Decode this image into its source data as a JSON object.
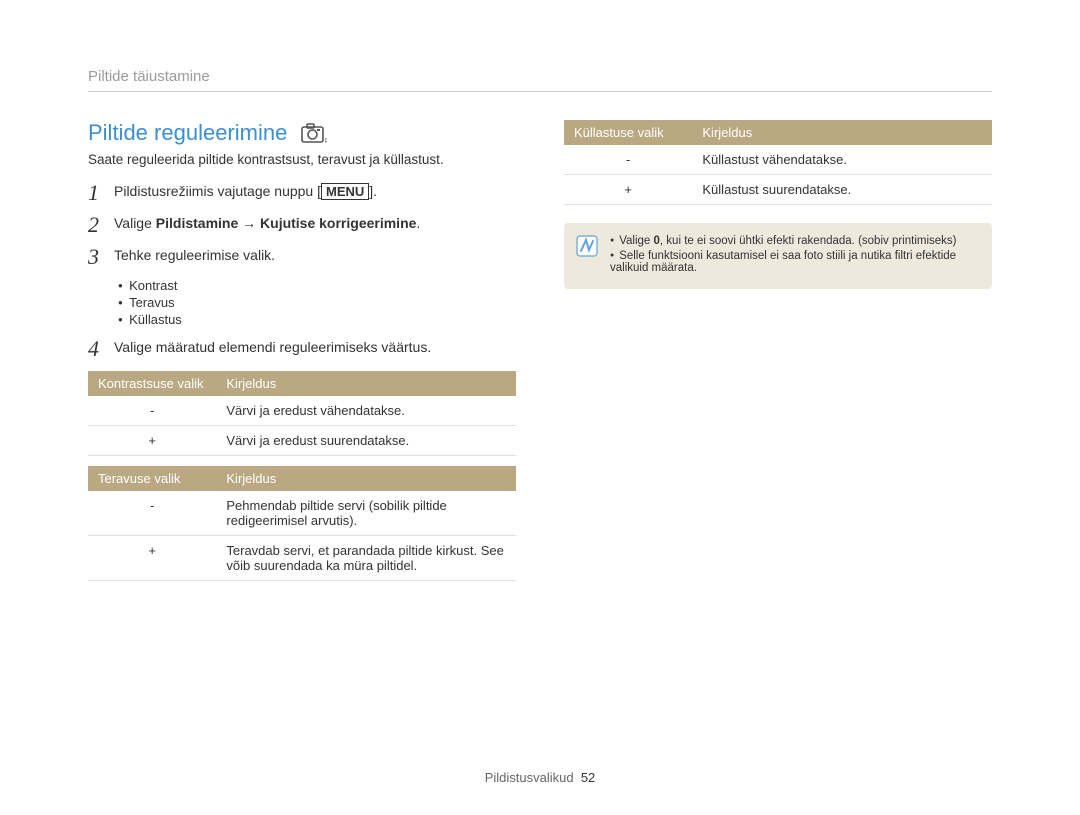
{
  "breadcrumb": "Piltide täiustamine",
  "heading": "Piltide reguleerimine",
  "icon_name": "camera-auto-icon",
  "intro": "Saate reguleerida piltide kontrastsust, teravust ja küllastust.",
  "steps": {
    "s1": {
      "num": "1",
      "pre": "Pildistusrežiimis vajutage nuppu ",
      "menu": "MENU",
      "post": "."
    },
    "s2": {
      "num": "2",
      "pre": "Valige ",
      "b1": "Pildistamine",
      "arrow": " → ",
      "b2": "Kujutise korrigeerimine",
      "post": "."
    },
    "s3": {
      "num": "3",
      "text": "Tehke reguleerimise valik."
    },
    "s4": {
      "num": "4",
      "text": "Valige määratud elemendi reguleerimiseks väärtus."
    }
  },
  "bullets": [
    "Kontrast",
    "Teravus",
    "Küllastus"
  ],
  "contrast_table": {
    "h1": "Kontrastsuse valik",
    "h2": "Kirjeldus",
    "rows": [
      {
        "opt": "-",
        "desc": "Värvi ja eredust vähendatakse."
      },
      {
        "opt": "+",
        "desc": "Värvi ja eredust suurendatakse."
      }
    ]
  },
  "sharpness_table": {
    "h1": "Teravuse valik",
    "h2": "Kirjeldus",
    "rows": [
      {
        "opt": "-",
        "desc": "Pehmendab piltide servi (sobilik piltide redigeerimisel arvutis)."
      },
      {
        "opt": "+",
        "desc": "Teravdab servi, et parandada piltide kirkust. See võib suurendada ka müra piltidel."
      }
    ]
  },
  "saturation_table": {
    "h1": "Küllastuse valik",
    "h2": "Kirjeldus",
    "rows": [
      {
        "opt": "-",
        "desc": "Küllastust vähendatakse."
      },
      {
        "opt": "+",
        "desc": "Küllastust suurendatakse."
      }
    ]
  },
  "note": {
    "item1_pre": "Valige ",
    "item1_bold": "0",
    "item1_post": ", kui te ei soovi ühtki efekti rakendada. (sobiv printimiseks)",
    "item2": "Selle funktsiooni kasutamisel ei saa foto stiili ja nutika filtri efektide valikuid määrata."
  },
  "footer": {
    "label": "Pildistusvalikud",
    "page": "52"
  }
}
